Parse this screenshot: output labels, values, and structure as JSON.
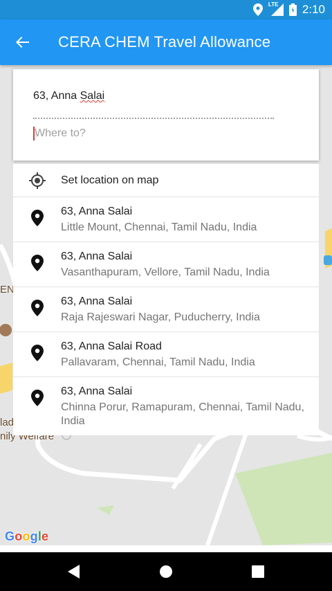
{
  "status_bar": {
    "time": "2:10",
    "network_label": "LTE",
    "icons": [
      "location-icon",
      "signal-icon",
      "battery-icon"
    ]
  },
  "app_bar": {
    "title": "CERA CHEM Travel Allowance",
    "back_icon": "arrow-back-icon",
    "color": "#2196f3"
  },
  "search": {
    "from_value": "63, Anna Salai",
    "from_prefix": "63, Anna ",
    "from_underlined_word": "Salai",
    "to_value": "",
    "to_placeholder": "Where to?"
  },
  "suggestions": {
    "set_location_label": "Set location on map",
    "items": [
      {
        "primary": "63, Anna Salai",
        "secondary": "Little Mount, Chennai, Tamil Nadu, India"
      },
      {
        "primary": "63, Anna Salai",
        "secondary": "Vasanthapuram, Vellore, Tamil Nadu, India"
      },
      {
        "primary": "63, Anna Salai",
        "secondary": "Raja Rajeswari Nagar, Puducherry, India"
      },
      {
        "primary": "63, Anna Salai Road",
        "secondary": "Pallavaram, Chennai, Tamil Nadu, India"
      },
      {
        "primary": "63, Anna Salai",
        "secondary": "Chinna Porur, Ramapuram, Chennai, Tamil Nadu, India"
      }
    ]
  },
  "map": {
    "labels": {
      "left_partial_1": "EN",
      "left_partial_2": "lad",
      "left_partial_3": "nily Welfare"
    },
    "attribution": "Google"
  },
  "nav_bar": {
    "icons": [
      "back-triangle-icon",
      "home-circle-icon",
      "recents-square-icon"
    ]
  }
}
